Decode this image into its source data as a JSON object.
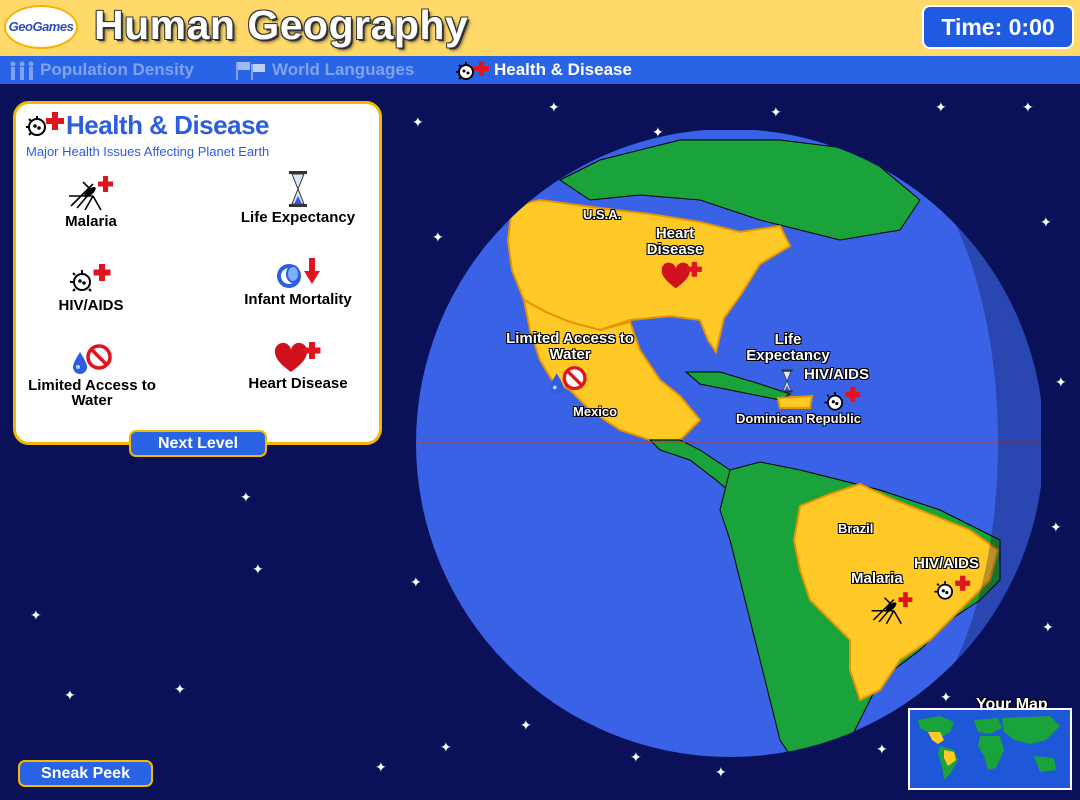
{
  "header": {
    "logo_text": "GeoGames",
    "title": "Human Geography",
    "timer_label": "Time: 0:00"
  },
  "tabs": [
    {
      "label": "Population Density",
      "icon": "people-icon",
      "active": false
    },
    {
      "label": "World Languages",
      "icon": "flags-icon",
      "active": false
    },
    {
      "label": "Health & Disease",
      "icon": "virus-cross-icon",
      "active": true
    }
  ],
  "panel": {
    "title": "Health & Disease",
    "subtitle": "Major Health Issues Affecting Planet Earth",
    "items": [
      {
        "label": "Malaria",
        "icon": "mosquito-icon"
      },
      {
        "label": "Life Expectancy",
        "icon": "hourglass-icon"
      },
      {
        "label": "HIV/AIDS",
        "icon": "virus-icon"
      },
      {
        "label": "Infant Mortality",
        "icon": "pacifier-down-arrow-icon"
      },
      {
        "label": "Limited Access to Water",
        "icon": "water-drop-no-icon"
      },
      {
        "label": "Heart Disease",
        "icon": "heart-cross-icon"
      }
    ],
    "next_button": "Next Level"
  },
  "map": {
    "countries": {
      "usa": "U.S.A.",
      "mexico": "Mexico",
      "dominican_republic": "Dominican Republic",
      "brazil": "Brazil"
    },
    "markers": {
      "usa_heart": "Heart Disease",
      "mexico_water": "Limited Access to Water",
      "dr_life": "Life Expectancy",
      "dr_hiv": "HIV/AIDS",
      "brazil_malaria": "Malaria",
      "brazil_hiv": "HIV/AIDS"
    },
    "colors": {
      "ocean": "#3a62e6",
      "land": "#1aa33a",
      "highlight": "#ffc928",
      "space": "#0a1158"
    }
  },
  "footer": {
    "sneak_peek": "Sneak Peek",
    "your_map": "Your Map"
  }
}
